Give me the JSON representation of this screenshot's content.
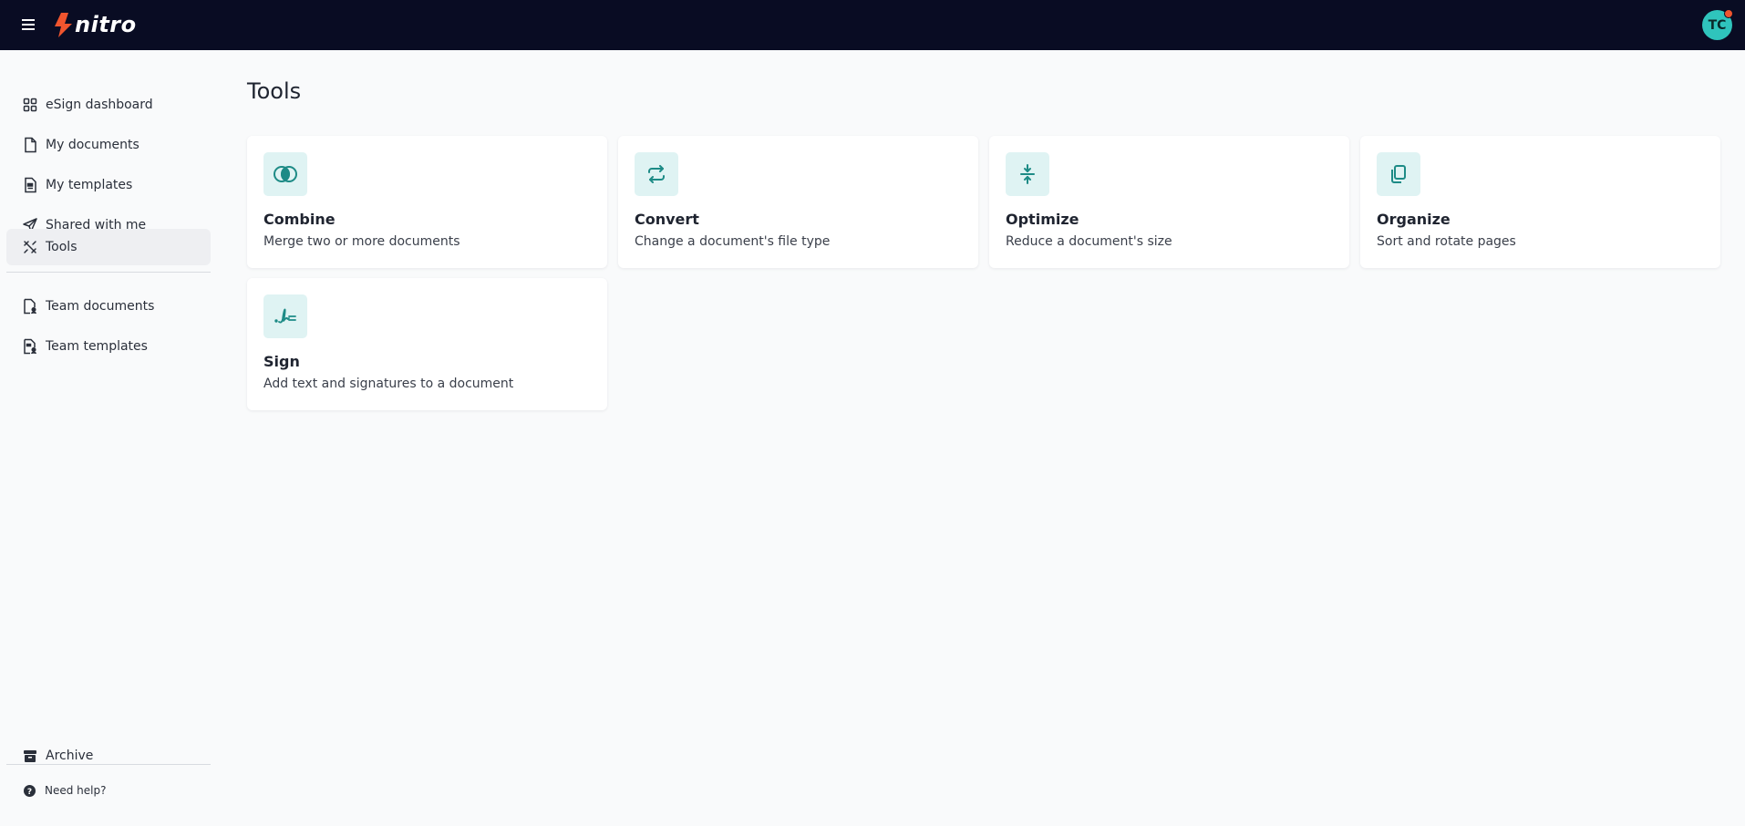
{
  "header": {
    "logo_text": "nitro",
    "avatar_initials": "TC"
  },
  "sidebar": {
    "items": [
      {
        "label": "eSign dashboard",
        "icon": "grid-icon"
      },
      {
        "label": "My documents",
        "icon": "document-icon"
      },
      {
        "label": "My templates",
        "icon": "template-icon"
      },
      {
        "label": "Shared with me",
        "icon": "send-icon"
      },
      {
        "label": "Tools",
        "icon": "tools-icon",
        "active": true
      },
      {
        "label": "Team documents",
        "icon": "team-document-icon"
      },
      {
        "label": "Team templates",
        "icon": "team-template-icon"
      }
    ],
    "archive_label": "Archive",
    "help_label": "Need help?"
  },
  "main": {
    "title": "Tools",
    "tools": [
      {
        "title": "Combine",
        "description": "Merge two or more documents",
        "icon": "combine-icon"
      },
      {
        "title": "Convert",
        "description": "Change a document's file type",
        "icon": "convert-icon"
      },
      {
        "title": "Optimize",
        "description": "Reduce a document's size",
        "icon": "optimize-icon"
      },
      {
        "title": "Organize",
        "description": "Sort and rotate pages",
        "icon": "organize-icon"
      },
      {
        "title": "Sign",
        "description": "Add text and signatures to a document",
        "icon": "signature-icon"
      }
    ]
  },
  "colors": {
    "topbar": "#090c23",
    "accent": "#1d8b86",
    "icon_tile": "#dff3f3",
    "avatar": "#2fc4bc",
    "notification": "#f0552e",
    "logo_mark": "#f0552e"
  }
}
